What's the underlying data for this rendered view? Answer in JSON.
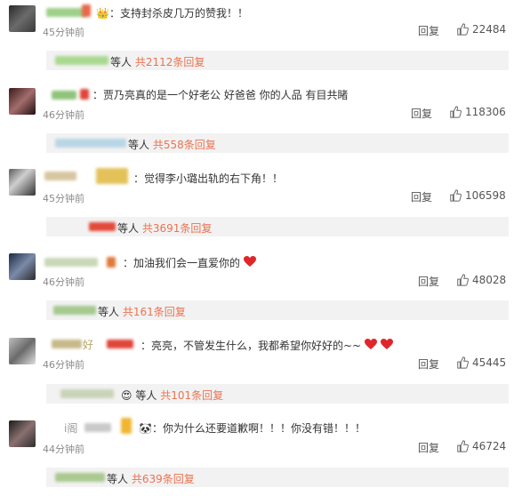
{
  "comments": [
    {
      "text": "：支持封杀皮几万的赞我！！",
      "time": "45分钟前",
      "reply_label": "回复",
      "likes": "22484",
      "sub_prefix": "等人",
      "sub_count": "共2112条回复"
    },
    {
      "text": "：贾乃亮真的是一个好老公 好爸爸 你的人品 有目共睹",
      "time": "46分钟前",
      "reply_label": "回复",
      "likes": "118306",
      "sub_prefix": "等人",
      "sub_count": "共558条回复"
    },
    {
      "text": "：觉得李小璐出轨的右下角！！",
      "time": "45分钟前",
      "reply_label": "回复",
      "likes": "106598",
      "sub_prefix": "等人",
      "sub_count": "共3691条回复"
    },
    {
      "text": "：加油我们会一直爱你的",
      "time": "46分钟前",
      "reply_label": "回复",
      "likes": "48028",
      "sub_prefix": "等人",
      "sub_count": "共161条回复"
    },
    {
      "name_fragment": "好",
      "text": "：亮亮，不管发生什么，我都希望你好好的~~",
      "time": "46分钟前",
      "reply_label": "回复",
      "likes": "45445",
      "sub_prefix": "等人",
      "sub_count": "共101条回复"
    },
    {
      "name_fragment": "i阁",
      "text": "：你为什么还要道歉啊！！！你没有错！！！",
      "time": "44分钟前",
      "reply_label": "回复",
      "likes": "46724",
      "sub_prefix": "等人",
      "sub_count": "共639条回复"
    }
  ],
  "colors": {
    "count_accent": "#eb7350",
    "subrow_bg": "#f2f2f2",
    "time_gray": "#8a8a8a",
    "heart_red": "#e0262b"
  }
}
